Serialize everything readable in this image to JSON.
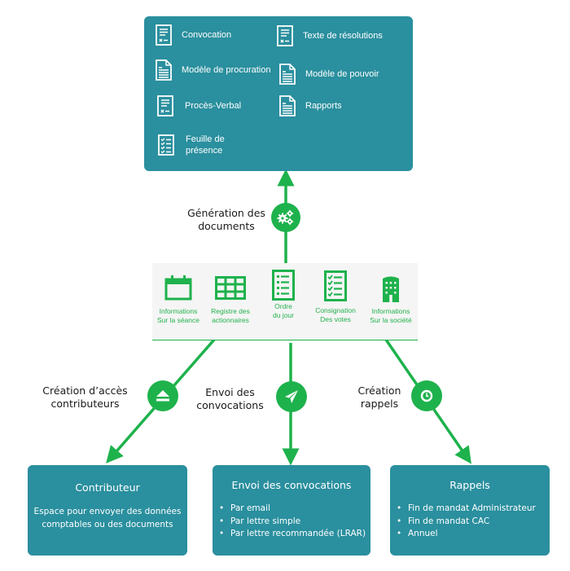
{
  "documents": {
    "items": [
      {
        "label": "Convocation",
        "icon": "form-document-icon"
      },
      {
        "label": "Texte de résolutions",
        "icon": "form-document-icon"
      },
      {
        "label": "Modèle de procuration",
        "icon": "page-document-icon"
      },
      {
        "label": "Modèle de pouvoir",
        "icon": "page-document-icon"
      },
      {
        "label": "Procès-Verbal",
        "icon": "form-document-icon"
      },
      {
        "label": "Rapports",
        "icon": "page-document-icon"
      },
      {
        "label_line1": "Feuille de",
        "label_line2": "présence",
        "icon": "checklist-icon"
      }
    ]
  },
  "generation": {
    "label_line1": "Génération des",
    "label_line2": "documents",
    "icon": "gears-icon"
  },
  "data_panel": {
    "items": [
      {
        "line1": "Informations",
        "line2": "Sur la séance",
        "icon": "calendar-icon"
      },
      {
        "line1": "Registre des",
        "line2": "actionnaires",
        "icon": "table-grid-icon"
      },
      {
        "line1": "Ordre",
        "line2": "du jour",
        "icon": "agenda-list-icon"
      },
      {
        "line1": "Consignation",
        "line2": "Des votes",
        "icon": "checklist-icon"
      },
      {
        "line1": "Informations",
        "line2": "Sur la société",
        "icon": "building-icon"
      }
    ]
  },
  "flows": [
    {
      "label_line1": "Création d’accès",
      "label_line2": "contributeurs",
      "icon": "eject-icon"
    },
    {
      "label_line1": "Envoi des",
      "label_line2": "convocations",
      "icon": "paper-plane-icon"
    },
    {
      "label_line1": "Création",
      "label_line2": "rappels",
      "icon": "clock-icon"
    }
  ],
  "outputs": {
    "contributeur": {
      "title": "Contributeur",
      "text_line1": "Espace pour envoyer des données",
      "text_line2": "comptables ou  des documents"
    },
    "convocations": {
      "title": "Envoi des convocations",
      "items": [
        "Par email",
        "Par lettre simple",
        "Par lettre recommandée (LRAR)"
      ]
    },
    "rappels": {
      "title": "Rappels",
      "items": [
        "Fin de mandat Administrateur",
        "Fin de mandat CAC",
        "Annuel"
      ]
    }
  },
  "colors": {
    "teal": "#2a8f9e",
    "green": "#1eb24c",
    "panel": "#f5f5f5"
  }
}
